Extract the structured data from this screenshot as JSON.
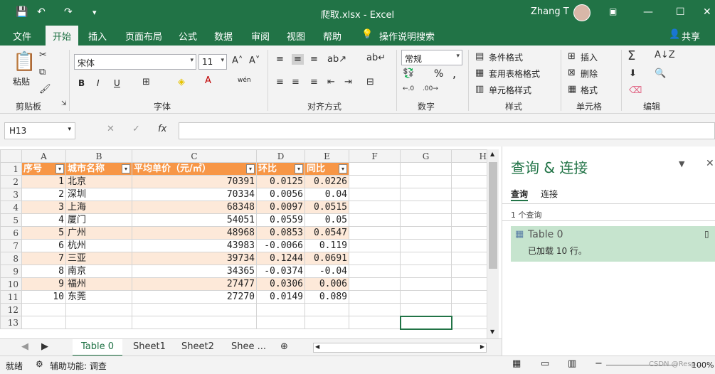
{
  "window": {
    "title": "爬取.xlsx  -  Excel",
    "user": "Zhang T"
  },
  "menu": {
    "tabs": [
      "文件",
      "开始",
      "插入",
      "页面布局",
      "公式",
      "数据",
      "审阅",
      "视图",
      "帮助",
      "操作说明搜索"
    ],
    "active": "开始",
    "share": "共享"
  },
  "ribbon": {
    "clipboard": {
      "paste": "粘贴",
      "label": "剪贴板"
    },
    "font": {
      "name": "宋体",
      "size": "11",
      "bold": "B",
      "italic": "I",
      "underline": "U",
      "wen": "wén",
      "label": "字体"
    },
    "align": {
      "label": "对齐方式"
    },
    "number": {
      "format": "常规",
      "percent": "%",
      "comma": ",",
      "label": "数字"
    },
    "styles": {
      "cond": "条件格式",
      "table": "套用表格格式",
      "cell": "单元格样式",
      "label": "样式"
    },
    "cells": {
      "insert": "插入",
      "delete": "删除",
      "format": "格式",
      "label": "单元格"
    },
    "editing": {
      "label": "编辑"
    }
  },
  "formula_bar": {
    "name_box": "H13",
    "fx": "fx"
  },
  "sheet": {
    "columns": [
      "A",
      "B",
      "C",
      "D",
      "E",
      "F",
      "G",
      "H"
    ],
    "headers": [
      "序号",
      "城市名称",
      "平均单价（元/㎡）",
      "环比",
      "同比"
    ],
    "rows": [
      [
        "1",
        "北京",
        "70391",
        "0.0125",
        "0.0226"
      ],
      [
        "2",
        "深圳",
        "70334",
        "0.0056",
        "0.04"
      ],
      [
        "3",
        "上海",
        "68348",
        "0.0097",
        "0.0515"
      ],
      [
        "4",
        "厦门",
        "54051",
        "0.0559",
        "0.05"
      ],
      [
        "5",
        "广州",
        "48968",
        "0.0853",
        "0.0547"
      ],
      [
        "6",
        "杭州",
        "43983",
        "-0.0066",
        "0.119"
      ],
      [
        "7",
        "三亚",
        "39734",
        "0.1244",
        "0.0691"
      ],
      [
        "8",
        "南京",
        "34365",
        "-0.0374",
        "-0.04"
      ],
      [
        "9",
        "福州",
        "27477",
        "0.0306",
        "0.006"
      ],
      [
        "10",
        "东莞",
        "27270",
        "0.0149",
        "0.089"
      ]
    ],
    "row_numbers": [
      "1",
      "2",
      "3",
      "4",
      "5",
      "6",
      "7",
      "8",
      "9",
      "10",
      "11",
      "12",
      "13",
      "14"
    ]
  },
  "sheet_tabs": [
    "Table 0",
    "Sheet1",
    "Sheet2",
    "Shee ..."
  ],
  "active_sheet": "Table 0",
  "status": {
    "ready": "就绪",
    "accessibility": "辅助功能: 调查",
    "zoom": "100%",
    "watermark": "CSDN @Resp..."
  },
  "pane": {
    "title": "查询 & 连接",
    "tabs": [
      "查询",
      "连接"
    ],
    "count": "1 个查询",
    "item_name": "Table 0",
    "item_status": "已加载 10 行。"
  },
  "colors": {
    "accent": "#217346",
    "header": "#f79646",
    "band": "#fde9d9"
  }
}
